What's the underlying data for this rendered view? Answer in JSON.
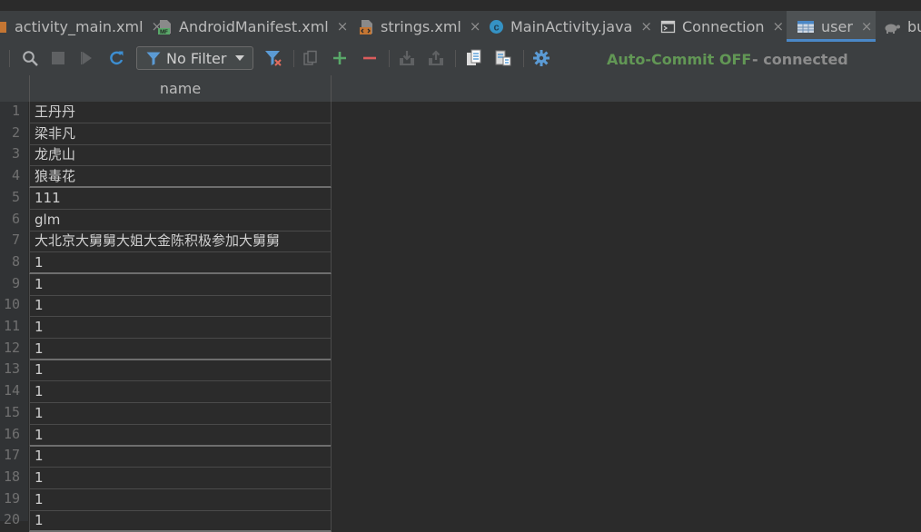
{
  "tabs": [
    {
      "label": "activity_main.xml",
      "icon": "layout-file-icon",
      "close": "×"
    },
    {
      "label": "AndroidManifest.xml",
      "icon": "manifest-file-icon",
      "badge": "MF",
      "close": "×"
    },
    {
      "label": "strings.xml",
      "icon": "xml-resource-file-icon",
      "close": "×"
    },
    {
      "label": "MainActivity.java",
      "icon": "java-class-icon",
      "badge": "c",
      "close": "×"
    },
    {
      "label": "Connection",
      "icon": "console-icon",
      "close": "×"
    },
    {
      "label": "user",
      "icon": "table-icon",
      "close": "×",
      "active": true
    },
    {
      "label": "bu",
      "icon": "turtle-icon"
    }
  ],
  "toolbar": {
    "filter_label": "No Filter",
    "commit_status": "Auto-Commit OFF",
    "connection_status": "- connected",
    "icons": [
      "search-icon",
      "stop-icon",
      "run-icon",
      "refresh-icon",
      "filter-icon",
      "clear-filter-icon",
      "copy-icon",
      "add-row-icon",
      "delete-row-icon",
      "import-icon",
      "export-icon",
      "clipboard-icon",
      "clipboard-paste-icon",
      "settings-icon"
    ]
  },
  "colors": {
    "background": "#2b2b2b",
    "panel": "#3c3f41",
    "accent": "#4a88c7",
    "commit_green": "#629755",
    "add_green": "#59a869",
    "delete_red": "#db5c5c"
  },
  "table": {
    "column": "name",
    "rows": [
      {
        "num": "1",
        "value": "王丹丹"
      },
      {
        "num": "2",
        "value": "梁非凡"
      },
      {
        "num": "3",
        "value": "龙虎山"
      },
      {
        "num": "4",
        "value": "狼毒花"
      },
      {
        "num": "5",
        "value": "111"
      },
      {
        "num": "6",
        "value": "glm"
      },
      {
        "num": "7",
        "value": "大北京大舅舅大姐大金陈积极参加大舅舅"
      },
      {
        "num": "8",
        "value": "1"
      },
      {
        "num": "9",
        "value": "1"
      },
      {
        "num": "10",
        "value": "1"
      },
      {
        "num": "11",
        "value": "1"
      },
      {
        "num": "12",
        "value": "1"
      },
      {
        "num": "13",
        "value": "1"
      },
      {
        "num": "14",
        "value": "1"
      },
      {
        "num": "15",
        "value": "1"
      },
      {
        "num": "16",
        "value": "1"
      },
      {
        "num": "17",
        "value": "1"
      },
      {
        "num": "18",
        "value": "1"
      },
      {
        "num": "19",
        "value": "1"
      },
      {
        "num": "20",
        "value": "1"
      }
    ]
  }
}
